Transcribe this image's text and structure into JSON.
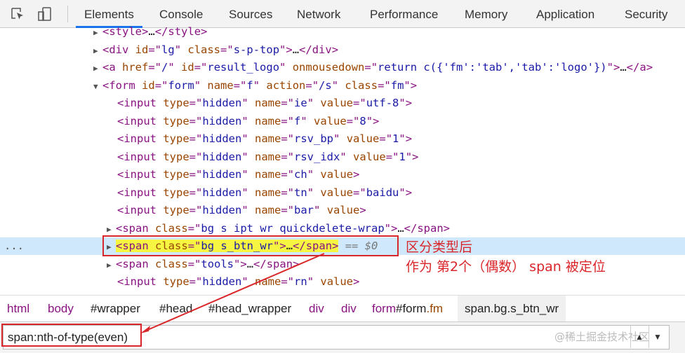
{
  "toolbar": {
    "tabs": [
      "Elements",
      "Console",
      "Sources",
      "Network",
      "Performance",
      "Memory",
      "Application",
      "Security"
    ],
    "active_tab": "Elements",
    "accent": "#1a73e8"
  },
  "dom_lines": [
    {
      "indent": 1,
      "arrow": "right",
      "tokens": [
        [
          "b",
          "<"
        ],
        [
          "t",
          "style"
        ],
        [
          "b",
          ">"
        ],
        [
          "x",
          "…"
        ],
        [
          "b",
          "</"
        ],
        [
          "t",
          "style"
        ],
        [
          "b",
          ">"
        ]
      ]
    },
    {
      "indent": 1,
      "arrow": "right",
      "tokens": [
        [
          "b",
          "<"
        ],
        [
          "t",
          "div "
        ],
        [
          "a",
          "id"
        ],
        [
          "b",
          "=\""
        ],
        [
          "v",
          "lg"
        ],
        [
          "b",
          "\" "
        ],
        [
          "a",
          "class"
        ],
        [
          "b",
          "=\""
        ],
        [
          "v",
          "s-p-top"
        ],
        [
          "b",
          "\">"
        ],
        [
          "x",
          "…"
        ],
        [
          "b",
          "</"
        ],
        [
          "t",
          "div"
        ],
        [
          "b",
          ">"
        ]
      ]
    },
    {
      "indent": 1,
      "arrow": "right",
      "tokens": [
        [
          "b",
          "<"
        ],
        [
          "t",
          "a "
        ],
        [
          "a",
          "href"
        ],
        [
          "b",
          "=\""
        ],
        [
          "v",
          "/"
        ],
        [
          "b",
          "\" "
        ],
        [
          "a",
          "id"
        ],
        [
          "b",
          "=\""
        ],
        [
          "v",
          "result_logo"
        ],
        [
          "b",
          "\" "
        ],
        [
          "a",
          "onmousedown"
        ],
        [
          "b",
          "=\""
        ],
        [
          "v",
          "return c({'fm':'tab','tab':'logo'})"
        ],
        [
          "b",
          "\">"
        ],
        [
          "x",
          "…"
        ],
        [
          "b",
          "</"
        ],
        [
          "t",
          "a"
        ],
        [
          "b",
          ">"
        ]
      ]
    },
    {
      "indent": 1,
      "arrow": "down",
      "tokens": [
        [
          "b",
          "<"
        ],
        [
          "t",
          "form "
        ],
        [
          "a",
          "id"
        ],
        [
          "b",
          "=\""
        ],
        [
          "v",
          "form"
        ],
        [
          "b",
          "\" "
        ],
        [
          "a",
          "name"
        ],
        [
          "b",
          "=\""
        ],
        [
          "v",
          "f"
        ],
        [
          "b",
          "\" "
        ],
        [
          "a",
          "action"
        ],
        [
          "b",
          "=\""
        ],
        [
          "v",
          "/s"
        ],
        [
          "b",
          "\" "
        ],
        [
          "a",
          "class"
        ],
        [
          "b",
          "=\""
        ],
        [
          "v",
          "fm"
        ],
        [
          "b",
          "\">"
        ]
      ]
    },
    {
      "indent": 2,
      "arrow": "",
      "tokens": [
        [
          "b",
          "<"
        ],
        [
          "t",
          "input "
        ],
        [
          "a",
          "type"
        ],
        [
          "b",
          "=\""
        ],
        [
          "v",
          "hidden"
        ],
        [
          "b",
          "\" "
        ],
        [
          "a",
          "name"
        ],
        [
          "b",
          "=\""
        ],
        [
          "v",
          "ie"
        ],
        [
          "b",
          "\" "
        ],
        [
          "a",
          "value"
        ],
        [
          "b",
          "=\""
        ],
        [
          "v",
          "utf-8"
        ],
        [
          "b",
          "\">"
        ]
      ]
    },
    {
      "indent": 2,
      "arrow": "",
      "tokens": [
        [
          "b",
          "<"
        ],
        [
          "t",
          "input "
        ],
        [
          "a",
          "type"
        ],
        [
          "b",
          "=\""
        ],
        [
          "v",
          "hidden"
        ],
        [
          "b",
          "\" "
        ],
        [
          "a",
          "name"
        ],
        [
          "b",
          "=\""
        ],
        [
          "v",
          "f"
        ],
        [
          "b",
          "\" "
        ],
        [
          "a",
          "value"
        ],
        [
          "b",
          "=\""
        ],
        [
          "v",
          "8"
        ],
        [
          "b",
          "\">"
        ]
      ]
    },
    {
      "indent": 2,
      "arrow": "",
      "tokens": [
        [
          "b",
          "<"
        ],
        [
          "t",
          "input "
        ],
        [
          "a",
          "type"
        ],
        [
          "b",
          "=\""
        ],
        [
          "v",
          "hidden"
        ],
        [
          "b",
          "\" "
        ],
        [
          "a",
          "name"
        ],
        [
          "b",
          "=\""
        ],
        [
          "v",
          "rsv_bp"
        ],
        [
          "b",
          "\" "
        ],
        [
          "a",
          "value"
        ],
        [
          "b",
          "=\""
        ],
        [
          "v",
          "1"
        ],
        [
          "b",
          "\">"
        ]
      ]
    },
    {
      "indent": 2,
      "arrow": "",
      "tokens": [
        [
          "b",
          "<"
        ],
        [
          "t",
          "input "
        ],
        [
          "a",
          "type"
        ],
        [
          "b",
          "=\""
        ],
        [
          "v",
          "hidden"
        ],
        [
          "b",
          "\" "
        ],
        [
          "a",
          "name"
        ],
        [
          "b",
          "=\""
        ],
        [
          "v",
          "rsv_idx"
        ],
        [
          "b",
          "\" "
        ],
        [
          "a",
          "value"
        ],
        [
          "b",
          "=\""
        ],
        [
          "v",
          "1"
        ],
        [
          "b",
          "\">"
        ]
      ]
    },
    {
      "indent": 2,
      "arrow": "",
      "tokens": [
        [
          "b",
          "<"
        ],
        [
          "t",
          "input "
        ],
        [
          "a",
          "type"
        ],
        [
          "b",
          "=\""
        ],
        [
          "v",
          "hidden"
        ],
        [
          "b",
          "\" "
        ],
        [
          "a",
          "name"
        ],
        [
          "b",
          "=\""
        ],
        [
          "v",
          "ch"
        ],
        [
          "b",
          "\" "
        ],
        [
          "a",
          "value"
        ],
        [
          "b",
          ">"
        ]
      ]
    },
    {
      "indent": 2,
      "arrow": "",
      "tokens": [
        [
          "b",
          "<"
        ],
        [
          "t",
          "input "
        ],
        [
          "a",
          "type"
        ],
        [
          "b",
          "=\""
        ],
        [
          "v",
          "hidden"
        ],
        [
          "b",
          "\" "
        ],
        [
          "a",
          "name"
        ],
        [
          "b",
          "=\""
        ],
        [
          "v",
          "tn"
        ],
        [
          "b",
          "\" "
        ],
        [
          "a",
          "value"
        ],
        [
          "b",
          "=\""
        ],
        [
          "v",
          "baidu"
        ],
        [
          "b",
          "\">"
        ]
      ]
    },
    {
      "indent": 2,
      "arrow": "",
      "tokens": [
        [
          "b",
          "<"
        ],
        [
          "t",
          "input "
        ],
        [
          "a",
          "type"
        ],
        [
          "b",
          "=\""
        ],
        [
          "v",
          "hidden"
        ],
        [
          "b",
          "\" "
        ],
        [
          "a",
          "name"
        ],
        [
          "b",
          "=\""
        ],
        [
          "v",
          "bar"
        ],
        [
          "b",
          "\" "
        ],
        [
          "a",
          "value"
        ],
        [
          "b",
          ">"
        ]
      ]
    },
    {
      "indent": 2,
      "arrow": "right",
      "tokens": [
        [
          "b",
          "<"
        ],
        [
          "t",
          "span "
        ],
        [
          "a",
          "class"
        ],
        [
          "b",
          "=\""
        ],
        [
          "v",
          "bg s ipt wr quickdelete-wrap"
        ],
        [
          "b",
          "\">"
        ],
        [
          "x",
          "…"
        ],
        [
          "b",
          "</"
        ],
        [
          "t",
          "span"
        ],
        [
          "b",
          ">"
        ]
      ]
    },
    {
      "indent": 2,
      "arrow": "right",
      "selected": true,
      "tokens": [
        [
          "b",
          "<"
        ],
        [
          "t",
          "span "
        ],
        [
          "a",
          "class"
        ],
        [
          "b",
          "=\""
        ],
        [
          "v",
          "bg s_btn_wr"
        ],
        [
          "b",
          "\">"
        ],
        [
          "x",
          "…"
        ],
        [
          "b",
          "</"
        ],
        [
          "t",
          "span"
        ],
        [
          "b",
          ">"
        ]
      ],
      "suffix": " == $0"
    },
    {
      "indent": 2,
      "arrow": "right",
      "tokens": [
        [
          "b",
          "<"
        ],
        [
          "t",
          "span "
        ],
        [
          "a",
          "class"
        ],
        [
          "b",
          "=\""
        ],
        [
          "v",
          "tools"
        ],
        [
          "b",
          "\">"
        ],
        [
          "x",
          "…"
        ],
        [
          "b",
          "</"
        ],
        [
          "t",
          "span"
        ],
        [
          "b",
          ">"
        ]
      ]
    },
    {
      "indent": 2,
      "arrow": "",
      "tokens": [
        [
          "b",
          "<"
        ],
        [
          "t",
          "input "
        ],
        [
          "a",
          "type"
        ],
        [
          "b",
          "=\""
        ],
        [
          "v",
          "hidden"
        ],
        [
          "b",
          "\" "
        ],
        [
          "a",
          "name"
        ],
        [
          "b",
          "=\""
        ],
        [
          "v",
          "rn"
        ],
        [
          "b",
          "\" "
        ],
        [
          "a",
          "value"
        ],
        [
          "b",
          ">"
        ]
      ]
    }
  ],
  "selected_dots": "...",
  "annotation": {
    "line1": "区分类型后",
    "line2": "作为 第2个（偶数） span 被定位",
    "color": "#d9262a"
  },
  "breadcrumbs": [
    {
      "parts": [
        [
          "t",
          "html"
        ]
      ]
    },
    {
      "parts": [
        [
          "t",
          "body"
        ]
      ]
    },
    {
      "parts": [
        [
          "x",
          "#wrapper"
        ]
      ]
    },
    {
      "parts": [
        [
          "x",
          "#head"
        ]
      ]
    },
    {
      "parts": [
        [
          "x",
          "#head_wrapper"
        ]
      ]
    },
    {
      "parts": [
        [
          "t",
          "div"
        ]
      ]
    },
    {
      "parts": [
        [
          "t",
          "div"
        ]
      ]
    },
    {
      "parts": [
        [
          "t",
          "form"
        ],
        [
          "x",
          "#form"
        ],
        [
          "a",
          ".fm"
        ]
      ]
    },
    {
      "parts": [
        [
          "x",
          "span.bg.s_btn_wr"
        ]
      ],
      "selected": true
    }
  ],
  "search": {
    "value": "span:nth-of-type(even)",
    "watermark": "@稀土掘金技术社区"
  }
}
